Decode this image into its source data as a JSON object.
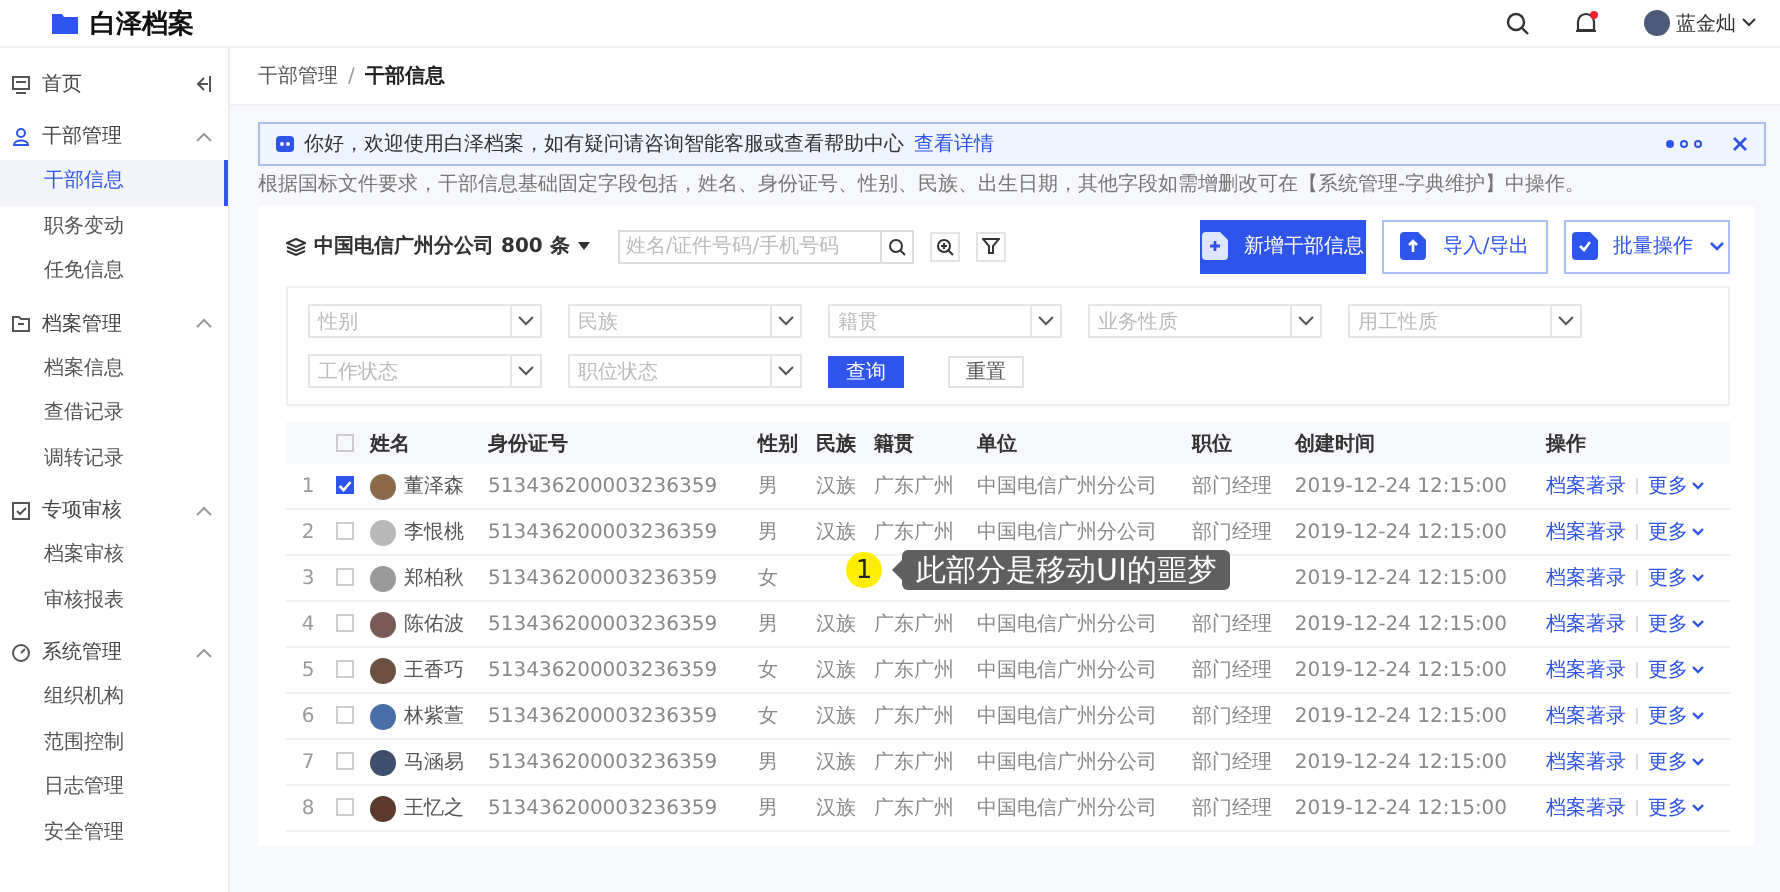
{
  "header": {
    "app_name": "白泽档案",
    "user_name": "蓝金灿",
    "has_notification": true
  },
  "sidebar": {
    "items": [
      {
        "label": "首页",
        "kind": "top"
      },
      {
        "label": "干部管理",
        "kind": "group",
        "expanded": true,
        "children": [
          {
            "label": "干部信息",
            "selected": true
          },
          {
            "label": "职务变动",
            "selected": false
          },
          {
            "label": "任免信息",
            "selected": false
          }
        ]
      },
      {
        "label": "档案管理",
        "kind": "group",
        "expanded": true,
        "children": [
          {
            "label": "档案信息",
            "selected": false
          },
          {
            "label": "查借记录",
            "selected": false
          },
          {
            "label": "调转记录",
            "selected": false
          }
        ]
      },
      {
        "label": "专项审核",
        "kind": "group",
        "expanded": true,
        "children": [
          {
            "label": "档案审核",
            "selected": false
          },
          {
            "label": "审核报表",
            "selected": false
          }
        ]
      },
      {
        "label": "系统管理",
        "kind": "group",
        "expanded": true,
        "children": [
          {
            "label": "组织机构",
            "selected": false
          },
          {
            "label": "范围控制",
            "selected": false
          },
          {
            "label": "日志管理",
            "selected": false
          },
          {
            "label": "安全管理",
            "selected": false
          }
        ]
      }
    ]
  },
  "breadcrumb": [
    "干部管理",
    "/",
    "干部信息"
  ],
  "notice": {
    "text": "你好，欢迎使用白泽档案，如有疑问请咨询智能客服或查看帮助中心",
    "link": "查看详情",
    "pages": [
      {
        "selected": true
      },
      {
        "selected": false
      },
      {
        "selected": false
      }
    ]
  },
  "description": "根据国标文件要求，干部信息基础固定字段包括，姓名、身份证号、性别、民族、出生日期，其他字段如需增删改可在【系统管理-字典维护】中操作。",
  "toolbar": {
    "org": "中国电信广州分公司 800 条",
    "search": {
      "placeholder": "姓名/证件号码/手机号码"
    },
    "buttons": [
      {
        "label": "新增干部信息",
        "kind": "primary",
        "dropdown": false
      },
      {
        "label": "导入/导出",
        "kind": "outline",
        "dropdown": false
      },
      {
        "label": "批量操作",
        "kind": "outline",
        "dropdown": true
      }
    ]
  },
  "filters": {
    "selects": [
      {
        "placeholder": "性别"
      },
      {
        "placeholder": "民族"
      },
      {
        "placeholder": "籍贯"
      },
      {
        "placeholder": "业务性质"
      },
      {
        "placeholder": "用工性质"
      },
      {
        "placeholder": "工作状态"
      },
      {
        "placeholder": "职位状态"
      }
    ],
    "buttons": [
      {
        "label": "查询",
        "kind": "primary"
      },
      {
        "label": "重置",
        "kind": "default"
      }
    ]
  },
  "table": {
    "columns": [
      "姓名",
      "身份证号",
      "性别",
      "民族",
      "籍贯",
      "单位",
      "职位",
      "创建时间",
      "操作"
    ],
    "all_checked": false,
    "rows": [
      {
        "index": "1",
        "checked": true,
        "name": "董泽森",
        "id": "513436200003236359",
        "gender": "男",
        "ethnic": "汉族",
        "origin": "广东广州",
        "unit": "中国电信广州分公司",
        "position": "部门经理",
        "created": "2019-12-24  12:15:00",
        "actions": [
          "档案著录",
          "更多"
        ]
      },
      {
        "index": "2",
        "checked": false,
        "name": "李恨桃",
        "id": "513436200003236359",
        "gender": "男",
        "ethnic": "汉族",
        "origin": "广东广州",
        "unit": "中国电信广州分公司",
        "position": "部门经理",
        "created": "2019-12-24  12:15:00",
        "actions": [
          "档案著录",
          "更多"
        ]
      },
      {
        "index": "3",
        "checked": false,
        "name": "郑柏秋",
        "id": "513436200003236359",
        "gender": "女",
        "created": "2019-12-24  12:15:00",
        "actions": [
          "档案著录",
          "更多"
        ]
      },
      {
        "index": "4",
        "checked": false,
        "name": "陈佑波",
        "id": "513436200003236359",
        "gender": "男",
        "ethnic": "汉族",
        "origin": "广东广州",
        "unit": "中国电信广州分公司",
        "position": "部门经理",
        "created": "2019-12-24  12:15:00",
        "actions": [
          "档案著录",
          "更多"
        ]
      },
      {
        "index": "5",
        "checked": false,
        "name": "王香巧",
        "id": "513436200003236359",
        "gender": "女",
        "ethnic": "汉族",
        "origin": "广东广州",
        "unit": "中国电信广州分公司",
        "position": "部门经理",
        "created": "2019-12-24  12:15:00",
        "actions": [
          "档案著录",
          "更多"
        ]
      },
      {
        "index": "6",
        "checked": false,
        "name": "林紫萱",
        "id": "513436200003236359",
        "gender": "女",
        "ethnic": "汉族",
        "origin": "广东广州",
        "unit": "中国电信广州分公司",
        "position": "部门经理",
        "created": "2019-12-24  12:15:00",
        "actions": [
          "档案著录",
          "更多"
        ]
      },
      {
        "index": "7",
        "checked": false,
        "name": "马涵易",
        "id": "513436200003236359",
        "gender": "男",
        "ethnic": "汉族",
        "origin": "广东广州",
        "unit": "中国电信广州分公司",
        "position": "部门经理",
        "created": "2019-12-24  12:15:00",
        "actions": [
          "档案著录",
          "更多"
        ]
      },
      {
        "index": "8",
        "checked": false,
        "name": "王忆之",
        "id": "513436200003236359",
        "gender": "男",
        "ethnic": "汉族",
        "origin": "广东广州",
        "unit": "中国电信广州分公司",
        "position": "部门经理",
        "created": "2019-12-24  12:15:00",
        "actions": [
          "档案著录",
          "更多"
        ]
      }
    ]
  },
  "annotation": {
    "number": "1",
    "text": "此部分是移动UI的噩梦"
  }
}
